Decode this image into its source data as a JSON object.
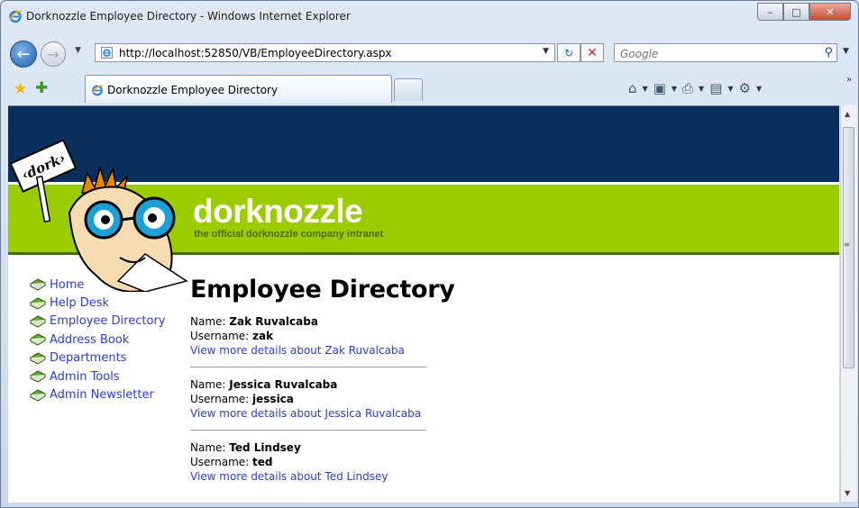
{
  "window": {
    "title": "Dorknozzle Employee Directory - Windows Internet Explorer"
  },
  "address_bar": {
    "url": "http://localhost:52850/VB/EmployeeDirectory.aspx"
  },
  "search": {
    "placeholder": "Google"
  },
  "tab": {
    "label": "Dorknozzle Employee Directory"
  },
  "header": {
    "site_name": "dorknozzle",
    "tagline": "the official dorknozzle company intranet",
    "mascot_sign": "‹dork›"
  },
  "nav": {
    "items": [
      {
        "label": "Home"
      },
      {
        "label": "Help Desk"
      },
      {
        "label": "Employee Directory"
      },
      {
        "label": "Address Book"
      },
      {
        "label": "Departments"
      },
      {
        "label": "Admin Tools"
      },
      {
        "label": "Admin Newsletter"
      }
    ]
  },
  "main": {
    "heading": "Employee Directory",
    "name_label": "Name: ",
    "username_label": "Username: ",
    "employees": [
      {
        "name": "Zak Ruvalcaba",
        "username": "zak",
        "link": "View more details about Zak Ruvalcaba"
      },
      {
        "name": "Jessica Ruvalcaba",
        "username": "jessica",
        "link": "View more details about Jessica Ruvalcaba"
      },
      {
        "name": "Ted Lindsey",
        "username": "ted",
        "link": "View more details about Ted Lindsey"
      }
    ]
  },
  "colors": {
    "header_dark": "#0b2f5c",
    "header_green": "#9acc00",
    "link": "#2a3ed9"
  }
}
